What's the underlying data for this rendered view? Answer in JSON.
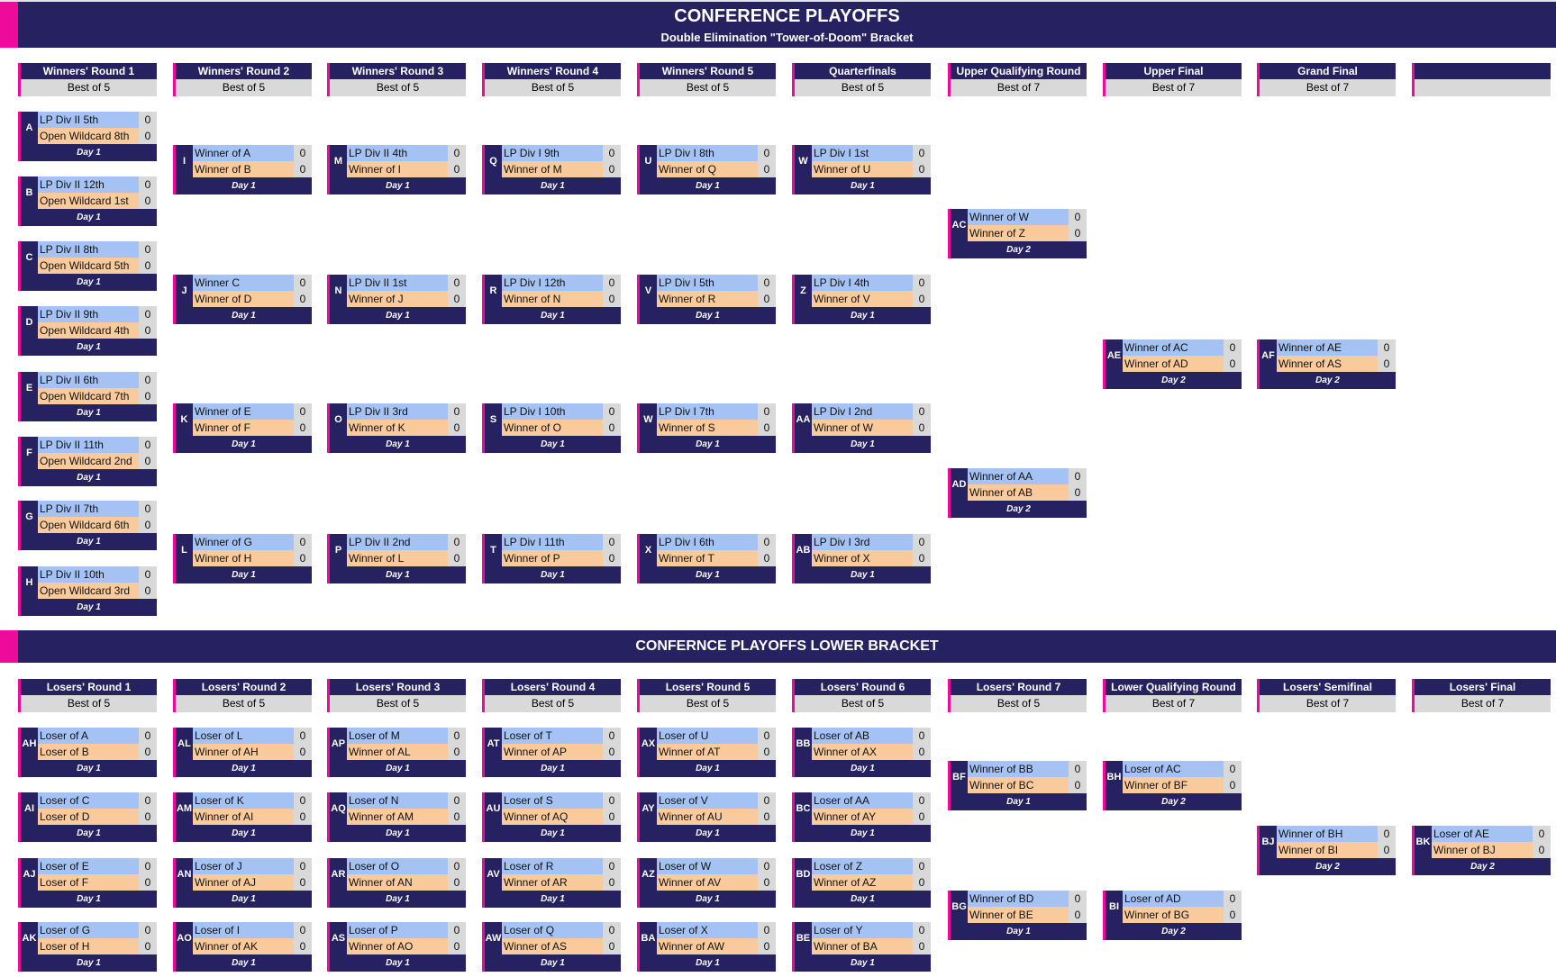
{
  "upper": {
    "title": "CONFERENCE PLAYOFFS",
    "subtitle": "Double Elimination \"Tower-of-Doom\" Bracket",
    "rounds": [
      {
        "name": "Winners' Round 1",
        "best_of": "Best of 5"
      },
      {
        "name": "Winners' Round 2",
        "best_of": "Best of 5"
      },
      {
        "name": "Winners' Round 3",
        "best_of": "Best of 5"
      },
      {
        "name": "Winners' Round 4",
        "best_of": "Best of 5"
      },
      {
        "name": "Winners' Round 5",
        "best_of": "Best of 5"
      },
      {
        "name": "Quarterfinals",
        "best_of": "Best of 5"
      },
      {
        "name": "Upper Qualifying Round",
        "best_of": "Best of 7"
      },
      {
        "name": "Upper Final",
        "best_of": "Best of 7"
      },
      {
        "name": "Grand Final",
        "best_of": "Best of 7"
      },
      {
        "name": "",
        "best_of": ""
      }
    ],
    "matches": [
      {
        "id": "A",
        "team1": "LP Div II 5th",
        "score1": "0",
        "team2": "Open Wildcard 8th",
        "score2": "0",
        "day": "Day 1"
      },
      {
        "id": "B",
        "team1": "LP Div II 12th",
        "score1": "0",
        "team2": "Open Wildcard 1st",
        "score2": "0",
        "day": "Day 1"
      },
      {
        "id": "C",
        "team1": "LP Div II 8th",
        "score1": "0",
        "team2": "Open Wildcard 5th",
        "score2": "0",
        "day": "Day 1"
      },
      {
        "id": "D",
        "team1": "LP Div II 9th",
        "score1": "0",
        "team2": "Open Wildcard 4th",
        "score2": "0",
        "day": "Day 1"
      },
      {
        "id": "E",
        "team1": "LP Div II 6th",
        "score1": "0",
        "team2": "Open Wildcard 7th",
        "score2": "0",
        "day": "Day 1"
      },
      {
        "id": "F",
        "team1": "LP Div II 11th",
        "score1": "0",
        "team2": "Open Wildcard 2nd",
        "score2": "0",
        "day": "Day 1"
      },
      {
        "id": "G",
        "team1": "LP Div II 7th",
        "score1": "0",
        "team2": "Open Wildcard 6th",
        "score2": "0",
        "day": "Day 1"
      },
      {
        "id": "H",
        "team1": "LP Div II 10th",
        "score1": "0",
        "team2": "Open Wildcard 3rd",
        "score2": "0",
        "day": "Day 1"
      },
      {
        "id": "I",
        "team1": "Winner of A",
        "score1": "0",
        "team2": "Winner of B",
        "score2": "0",
        "day": "Day 1"
      },
      {
        "id": "J",
        "team1": "Winner C",
        "score1": "0",
        "team2": "Winner of D",
        "score2": "0",
        "day": "Day 1"
      },
      {
        "id": "K",
        "team1": "Winner of E",
        "score1": "0",
        "team2": "Winner of F",
        "score2": "0",
        "day": "Day 1"
      },
      {
        "id": "L",
        "team1": "Winner of G",
        "score1": "0",
        "team2": "Winner of H",
        "score2": "0",
        "day": "Day 1"
      },
      {
        "id": "M",
        "team1": "LP Div II 4th",
        "score1": "0",
        "team2": "Winner of I",
        "score2": "0",
        "day": "Day 1"
      },
      {
        "id": "N",
        "team1": "LP Div II 1st",
        "score1": "0",
        "team2": "Winner of J",
        "score2": "0",
        "day": "Day 1"
      },
      {
        "id": "O",
        "team1": "LP Div II 3rd",
        "score1": "0",
        "team2": "Winner of K",
        "score2": "0",
        "day": "Day 1"
      },
      {
        "id": "P",
        "team1": "LP Div II 2nd",
        "score1": "0",
        "team2": "Winner of L",
        "score2": "0",
        "day": "Day 1"
      },
      {
        "id": "Q",
        "team1": "LP Div I 9th",
        "score1": "0",
        "team2": "Winner of M",
        "score2": "0",
        "day": "Day 1"
      },
      {
        "id": "R",
        "team1": "LP Div I 12th",
        "score1": "0",
        "team2": "Winner of N",
        "score2": "0",
        "day": "Day 1"
      },
      {
        "id": "S",
        "team1": "LP Div I 10th",
        "score1": "0",
        "team2": "Winner of O",
        "score2": "0",
        "day": "Day 1"
      },
      {
        "id": "T",
        "team1": "LP Div I 11th",
        "score1": "0",
        "team2": "Winner of P",
        "score2": "0",
        "day": "Day 1"
      },
      {
        "id": "U",
        "team1": "LP Div I 8th",
        "score1": "0",
        "team2": "Winner of Q",
        "score2": "0",
        "day": "Day 1"
      },
      {
        "id": "V",
        "team1": "LP Div I 5th",
        "score1": "0",
        "team2": "Winner of R",
        "score2": "0",
        "day": "Day 1"
      },
      {
        "id": "W",
        "team1": "LP Div I 7th",
        "score1": "0",
        "team2": "Winner of S",
        "score2": "0",
        "day": "Day 1"
      },
      {
        "id": "X",
        "team1": "LP Div I 6th",
        "score1": "0",
        "team2": "Winner of T",
        "score2": "0",
        "day": "Day 1"
      },
      {
        "id": "W",
        "team1": "LP Div I 1st",
        "score1": "0",
        "team2": "Winner of U",
        "score2": "0",
        "day": "Day 1"
      },
      {
        "id": "Z",
        "team1": "LP Div I 4th",
        "score1": "0",
        "team2": "Winner of V",
        "score2": "0",
        "day": "Day 1"
      },
      {
        "id": "AA",
        "team1": "LP Div I 2nd",
        "score1": "0",
        "team2": "Winner of W",
        "score2": "0",
        "day": "Day 1"
      },
      {
        "id": "AB",
        "team1": "LP Div I 3rd",
        "score1": "0",
        "team2": "Winner of X",
        "score2": "0",
        "day": "Day 1"
      },
      {
        "id": "AC",
        "team1": "Winner of W",
        "score1": "0",
        "team2": "Winner of Z",
        "score2": "0",
        "day": "Day 2"
      },
      {
        "id": "AD",
        "team1": "Winner of AA",
        "score1": "0",
        "team2": "Winner of AB",
        "score2": "0",
        "day": "Day 2"
      },
      {
        "id": "AE",
        "team1": "Winner of AC",
        "score1": "0",
        "team2": "Winner of AD",
        "score2": "0",
        "day": "Day 2"
      },
      {
        "id": "AF",
        "team1": "Winner of AE",
        "score1": "0",
        "team2": "Winner of AS",
        "score2": "0",
        "day": "Day 2"
      }
    ]
  },
  "lower": {
    "title": "CONFERNCE PLAYOFFS LOWER BRACKET",
    "rounds": [
      {
        "name": "Losers' Round 1",
        "best_of": "Best of 5"
      },
      {
        "name": "Losers' Round 2",
        "best_of": "Best of 5"
      },
      {
        "name": "Losers' Round 3",
        "best_of": "Best of 5"
      },
      {
        "name": "Losers' Round 4",
        "best_of": "Best of 5"
      },
      {
        "name": "Losers' Round 5",
        "best_of": "Best of 5"
      },
      {
        "name": "Losers' Round 6",
        "best_of": "Best of 5"
      },
      {
        "name": "Losers' Round 7",
        "best_of": "Best of 5"
      },
      {
        "name": "Lower Qualifying Round",
        "best_of": "Best of 7"
      },
      {
        "name": "Losers' Semifinal",
        "best_of": "Best of 7"
      },
      {
        "name": "Losers' Final",
        "best_of": "Best of 7"
      }
    ],
    "matches": [
      {
        "id": "AH",
        "team1": "Loser of A",
        "score1": "0",
        "team2": "Loser of B",
        "score2": "0",
        "day": "Day 1"
      },
      {
        "id": "AI",
        "team1": "Loser of C",
        "score1": "0",
        "team2": "Loser of D",
        "score2": "0",
        "day": "Day 1"
      },
      {
        "id": "AJ",
        "team1": "Loser of E",
        "score1": "0",
        "team2": "Loser of F",
        "score2": "0",
        "day": "Day 1"
      },
      {
        "id": "AK",
        "team1": "Loser of G",
        "score1": "0",
        "team2": "Loser of H",
        "score2": "0",
        "day": "Day 1"
      },
      {
        "id": "AL",
        "team1": "Loser of L",
        "score1": "0",
        "team2": "Winner of AH",
        "score2": "0",
        "day": "Day 1"
      },
      {
        "id": "AM",
        "team1": "Loser of K",
        "score1": "0",
        "team2": "Winner of AI",
        "score2": "0",
        "day": "Day 1"
      },
      {
        "id": "AN",
        "team1": "Loser of J",
        "score1": "0",
        "team2": "Winner of AJ",
        "score2": "0",
        "day": "Day 1"
      },
      {
        "id": "AO",
        "team1": "Loser of I",
        "score1": "0",
        "team2": "Winner of AK",
        "score2": "0",
        "day": "Day 1"
      },
      {
        "id": "AP",
        "team1": "Loser of M",
        "score1": "0",
        "team2": "Winner of AL",
        "score2": "0",
        "day": "Day 1"
      },
      {
        "id": "AQ",
        "team1": "Loser of N",
        "score1": "0",
        "team2": "Winner of AM",
        "score2": "0",
        "day": "Day 1"
      },
      {
        "id": "AR",
        "team1": "Loser of O",
        "score1": "0",
        "team2": "Winner of AN",
        "score2": "0",
        "day": "Day 1"
      },
      {
        "id": "AS",
        "team1": "Loser of P",
        "score1": "0",
        "team2": "Winner of AO",
        "score2": "0",
        "day": "Day 1"
      },
      {
        "id": "AT",
        "team1": "Loser of T",
        "score1": "0",
        "team2": "Winner of AP",
        "score2": "0",
        "day": "Day 1"
      },
      {
        "id": "AU",
        "team1": "Loser of S",
        "score1": "0",
        "team2": "Winner of AQ",
        "score2": "0",
        "day": "Day 1"
      },
      {
        "id": "AV",
        "team1": "Loser of R",
        "score1": "0",
        "team2": "Winner of AR",
        "score2": "0",
        "day": "Day 1"
      },
      {
        "id": "AW",
        "team1": "Loser of Q",
        "score1": "0",
        "team2": "Winner of AS",
        "score2": "0",
        "day": "Day 1"
      },
      {
        "id": "AX",
        "team1": "Loser of U",
        "score1": "0",
        "team2": "Winner of AT",
        "score2": "0",
        "day": "Day 1"
      },
      {
        "id": "AY",
        "team1": "Loser of V",
        "score1": "0",
        "team2": "Winner of AU",
        "score2": "0",
        "day": "Day 1"
      },
      {
        "id": "AZ",
        "team1": "Loser of W",
        "score1": "0",
        "team2": "Winner of AV",
        "score2": "0",
        "day": "Day 1"
      },
      {
        "id": "BA",
        "team1": "Loser of X",
        "score1": "0",
        "team2": "Winner of AW",
        "score2": "0",
        "day": "Day 1"
      },
      {
        "id": "BB",
        "team1": "Loser of AB",
        "score1": "0",
        "team2": "Winner of AX",
        "score2": "0",
        "day": "Day 1"
      },
      {
        "id": "BC",
        "team1": "Loser of AA",
        "score1": "0",
        "team2": "Winner of AY",
        "score2": "0",
        "day": "Day 1"
      },
      {
        "id": "BD",
        "team1": "Loser of Z",
        "score1": "0",
        "team2": "Winner of AZ",
        "score2": "0",
        "day": "Day 1"
      },
      {
        "id": "BE",
        "team1": "Loser of Y",
        "score1": "0",
        "team2": "Winner of BA",
        "score2": "0",
        "day": "Day 1"
      },
      {
        "id": "BF",
        "team1": "Winner of BB",
        "score1": "0",
        "team2": "Winner of BC",
        "score2": "0",
        "day": "Day 1"
      },
      {
        "id": "BG",
        "team1": "Winner of BD",
        "score1": "0",
        "team2": "Winner of BE",
        "score2": "0",
        "day": "Day 1"
      },
      {
        "id": "BH",
        "team1": "Loser of AC",
        "score1": "0",
        "team2": "Winner of BF",
        "score2": "0",
        "day": "Day 2"
      },
      {
        "id": "BI",
        "team1": "Loser of AD",
        "score1": "0",
        "team2": "Winner of BG",
        "score2": "0",
        "day": "Day 2"
      },
      {
        "id": "BJ",
        "team1": "Winner of BH",
        "score1": "0",
        "team2": "Winner of BI",
        "score2": "0",
        "day": "Day 2"
      },
      {
        "id": "BK",
        "team1": "Loser of AE",
        "score1": "0",
        "team2": "Winner of BJ",
        "score2": "0",
        "day": "Day 2"
      }
    ]
  },
  "colors": {
    "navy": "#262261",
    "magenta": "#ee0a9b",
    "team1_bg": "#a4c2f4",
    "team2_bg": "#f9cb9c",
    "score_bg": "#d9d9d9"
  }
}
